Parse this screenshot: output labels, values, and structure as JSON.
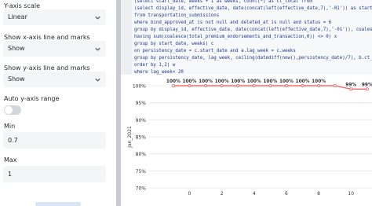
{
  "settings": {
    "y_axis_scale": {
      "label": "Y-axis scale",
      "value": "Linear"
    },
    "show_x_axis": {
      "label": "Show x-axis line and marks",
      "value": "Show"
    },
    "show_y_axis": {
      "label": "Show y-axis line and marks",
      "value": "Show"
    },
    "auto_y_range": {
      "label": "Auto y-axis range",
      "enabled": false
    },
    "min": {
      "label": "Min",
      "value": "0.7"
    },
    "max": {
      "label": "Max",
      "value": "1"
    }
  },
  "editor": {
    "lines": [
      {
        "n": "",
        "text": "(select start_date, weeks + 1 as weeks, count(*) as ct_local from"
      },
      {
        "n": "",
        "text": "(select display_id, effective_date, date(concat(left(effective_date,7),'-01')) as start_date,coalesce("
      },
      {
        "n": "",
        "text": "from transportation_submissions"
      },
      {
        "n": "",
        "text": "where bind_approved_at is not null and deleted_at is null and status = 6"
      },
      {
        "n": "",
        "text": "group by display_id, effective_date, date(concat(left(effective_date,7),'-01')), coalesce(ceiling("
      },
      {
        "n": "",
        "text": "having sum(coalesce(total_premium_endorsements_and_transaction,0)) <> 0) x"
      },
      {
        "n": "",
        "text": "group by start_date, weeks) c"
      },
      {
        "n": "",
        "text": "on persistency_date = c.start_date and a.lag_week = c.weeks"
      },
      {
        "n": "",
        "text": "group by persistency_date, lag_week, ceiling(datediff(now(),persistency_date)/7), b.ct_policy"
      },
      {
        "n": "",
        "text": "order by 1,2) w"
      },
      {
        "n": "",
        "text": "where lag_week< 20"
      },
      {
        "n": "",
        "text": "group by 1"
      }
    ]
  },
  "chart_data": {
    "type": "line",
    "ylabel": "Jan_2021",
    "ylim": [
      0.7,
      1.0
    ],
    "yticks": [
      "100%",
      "95%",
      "90%",
      "85%",
      "80%",
      "75%",
      "70%"
    ],
    "xticks": [
      "0",
      "2",
      "4",
      "6",
      "8",
      "10"
    ],
    "xlim": [
      -2.5,
      11.3
    ],
    "series": [
      {
        "x": [
          -1,
          0,
          1,
          2,
          3,
          4,
          5,
          6,
          7,
          8,
          9,
          10,
          11
        ],
        "values": [
          1.0,
          1.0,
          1.0,
          1.0,
          1.0,
          1.0,
          1.0,
          1.0,
          1.0,
          1.0,
          1.0,
          0.99,
          0.99
        ],
        "labels": [
          "100%",
          "100%",
          "100%",
          "100%",
          "100%",
          "100%",
          "100%",
          "100%",
          "100%",
          "100%",
          "",
          "99%",
          "99%"
        ]
      }
    ],
    "colors": {
      "line": "#ef6b6b",
      "grid": "#e4e6ea",
      "text": "#2b2f36"
    },
    "grid": true
  }
}
